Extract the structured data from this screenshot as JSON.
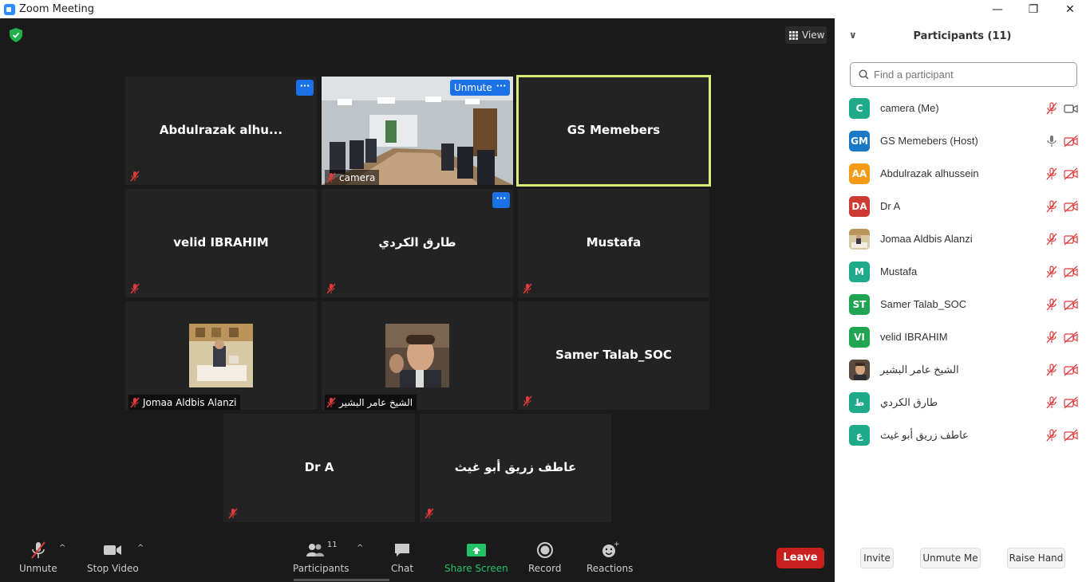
{
  "window": {
    "title": "Zoom Meeting",
    "min": "—",
    "max": "❐",
    "close": "✕"
  },
  "meeting": {
    "view_label": "View"
  },
  "tiles": [
    {
      "name": "Abdulrazak  alhu..."
    },
    {
      "name": "camera",
      "unmute_label": "Unmute"
    },
    {
      "name": "GS Memebers"
    },
    {
      "name": "velid  IBRAHIM"
    },
    {
      "name": "طارق الكردي"
    },
    {
      "name": "Mustafa"
    },
    {
      "name": "Jomaa Aldbis Alanzi"
    },
    {
      "name": "الشيخ عامر البشير"
    },
    {
      "name": "Samer Talab_SOC"
    },
    {
      "name": "Dr A"
    },
    {
      "name": "عاطف زريق أبو غيث"
    }
  ],
  "toolbar": {
    "unmute": "Unmute",
    "stop_video": "Stop Video",
    "participants": "Participants",
    "participants_count": "11",
    "chat": "Chat",
    "share_screen": "Share Screen",
    "record": "Record",
    "reactions": "Reactions",
    "leave": "Leave"
  },
  "panel": {
    "title": "Participants (11)",
    "search_placeholder": "Find a participant",
    "participants": [
      {
        "initials": "C",
        "name": "camera (Me)",
        "color": "#1faa8a"
      },
      {
        "initials": "GM",
        "name": "GS Memebers (Host)",
        "color": "#1a79c6"
      },
      {
        "initials": "AA",
        "name": "Abdulrazak alhussein",
        "color": "#f39a16"
      },
      {
        "initials": "DA",
        "name": "Dr A",
        "color": "#cc3a33"
      },
      {
        "initials": "",
        "name": "Jomaa Aldbis Alanzi",
        "color": "#c9b27a"
      },
      {
        "initials": "M",
        "name": "Mustafa",
        "color": "#1faa8a"
      },
      {
        "initials": "ST",
        "name": "Samer Talab_SOC",
        "color": "#22a552"
      },
      {
        "initials": "VI",
        "name": "velid  IBRAHIM",
        "color": "#22a552"
      },
      {
        "initials": "",
        "name": "الشيخ عامر البشير",
        "color": "#7a5b47"
      },
      {
        "initials": "ط",
        "name": "طارق الكردي",
        "color": "#1faa8a"
      },
      {
        "initials": "ع",
        "name": "عاطف زريق أبو غيث",
        "color": "#1faa8a"
      }
    ],
    "invite": "Invite",
    "unmute_me": "Unmute Me",
    "raise_hand": "Raise Hand"
  }
}
